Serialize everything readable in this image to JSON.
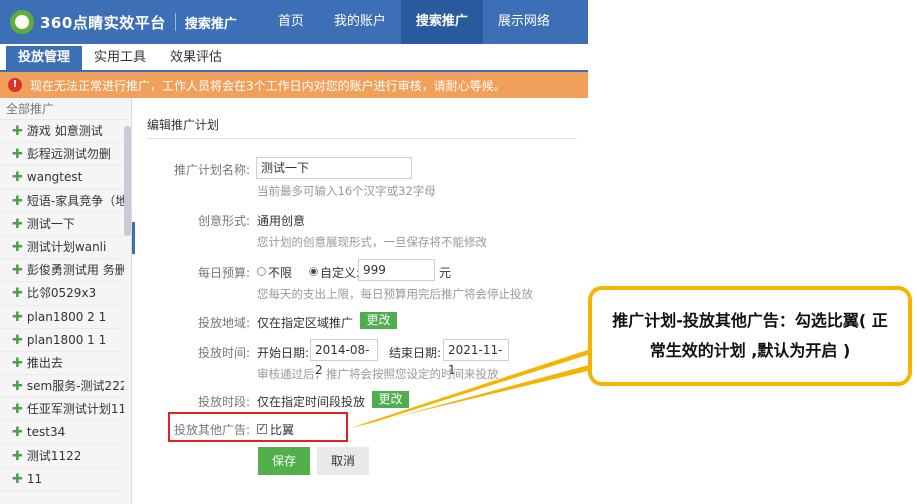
{
  "brand": {
    "name": "360点睛实效平台",
    "sub": "搜索推广"
  },
  "top_nav": [
    "首页",
    "我的账户",
    "搜索推广",
    "展示网络"
  ],
  "sub_tabs": [
    "投放管理",
    "实用工具",
    "效果评估"
  ],
  "notice": {
    "icon": "!",
    "text": "现在无法正常进行推广，工作人员将会在3个工作日内对您的账户进行审核，请耐心等候。"
  },
  "sidebar": {
    "header": "全部推广",
    "items": [
      "游戏 如意测试",
      "彭程远测试勿删",
      "wangtest",
      "短语-家具竞争（地总",
      "测试一下",
      "测试计划wanli",
      "彭俊勇测试用 务删",
      "比邻0529x3",
      "plan1800 2 1",
      "plan1800 1 1",
      "推出去",
      "sem服务-测试222",
      "任亚军测试计划11",
      "test34",
      "测试1122",
      "11"
    ]
  },
  "form": {
    "title": "编辑推广计划",
    "name_label": "推广计划名称:",
    "name_value": "测试一下",
    "name_hint": "当前最多可输入16个汉字或32字母",
    "creative_label": "创意形式:",
    "creative_value": "通用创意",
    "creative_hint": "您计划的创意展现形式，一旦保存将不能修改",
    "budget_label": "每日预算:",
    "budget_unlimited": "不限",
    "budget_custom": "自定义:",
    "budget_value": "999",
    "budget_unit": "元",
    "budget_hint": "您每天的支出上限，每日预算用完后推广将会停止投放",
    "region_label": "投放地域:",
    "region_value": "仅在指定区域推广",
    "change_label": "更改",
    "time_label": "投放时间:",
    "start_label": "开始日期:",
    "start_value": "2014-08-2",
    "end_label": "结束日期:",
    "end_value": "2021-11-1",
    "time_hint": "审核通过后，推广将会按照您设定的时间来投放",
    "period_label": "投放时段:",
    "period_value": "仅在指定时间段投放",
    "other_label": "投放其他广告:",
    "other_option": "比翼",
    "save": "保存",
    "cancel": "取消"
  },
  "callout": "推广计划-投放其他广告：勾选比翼( 正常生效的计划 ,默认为开启 )"
}
